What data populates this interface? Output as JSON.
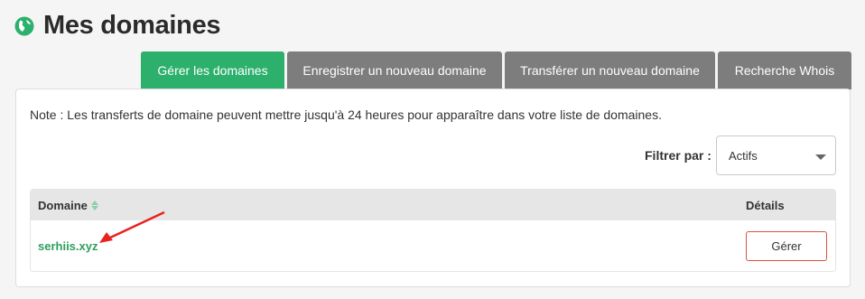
{
  "header": {
    "title": "Mes domaines",
    "icon": "globe-icon",
    "icon_color": "#2cb06c"
  },
  "tabs": [
    {
      "label": "Gérer les domaines",
      "active": true
    },
    {
      "label": "Enregistrer un nouveau domaine",
      "active": false
    },
    {
      "label": "Transférer un nouveau domaine",
      "active": false
    },
    {
      "label": "Recherche Whois",
      "active": false
    }
  ],
  "colors": {
    "accent": "#2cb06c",
    "tab_inactive": "#7d7d7d",
    "button_border": "#d9533f",
    "annotation_arrow": "#e8231f"
  },
  "main": {
    "note": "Note : Les transferts de domaine peuvent mettre jusqu'à 24 heures pour apparaître dans votre liste de domaines.",
    "filter": {
      "label": "Filtrer par :",
      "selected": "Actifs"
    },
    "table": {
      "columns": [
        "Domaine",
        "Détails"
      ],
      "rows": [
        {
          "domain": "serhiis.xyz",
          "action": "Gérer"
        }
      ]
    }
  }
}
